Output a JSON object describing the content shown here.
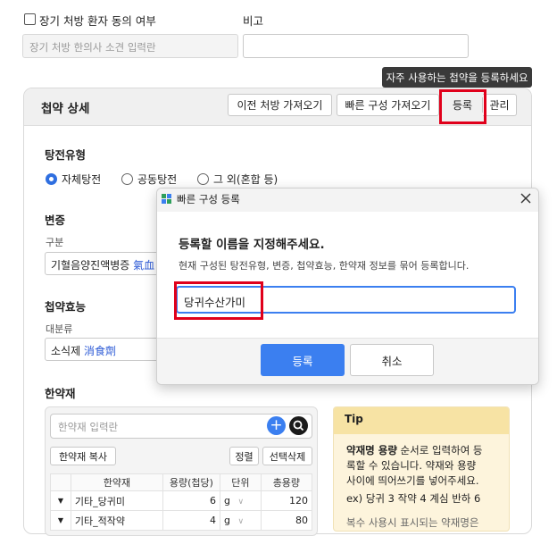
{
  "top": {
    "consent_label": "장기 처방 환자 동의 여부",
    "consent_placeholder": "장기 처방 한의사 소견 입력란",
    "memo_label": "비고",
    "memo_value": ""
  },
  "tooltip": {
    "text": "자주 사용하는 첩약을 등록하세요"
  },
  "card": {
    "title": "첩약 상세",
    "buttons": {
      "prev": "이전 처방 가져오기",
      "quick": "빠른 구성 가져오기",
      "register": "등록",
      "manage": "관리"
    },
    "decoction": {
      "title": "탕전유형",
      "options": [
        "자체탕전",
        "공동탕전",
        "그 외(혼합 등)"
      ],
      "selected": "자체탕전"
    },
    "pattern": {
      "title": "변증",
      "sub_label": "구분",
      "value": "기혈음양진액병증",
      "value_hanja": "氣血"
    },
    "efficacy": {
      "title": "첩약효능",
      "sub_label": "대분류",
      "value": "소식제",
      "value_hanja": "消食劑"
    },
    "herbs": {
      "title": "한약재",
      "search_placeholder": "한약재 입력란",
      "copy_button": "한약재 복사",
      "sort_button": "정렬",
      "delete_button": "선택삭제",
      "columns": [
        "한약재",
        "용량(첩당)",
        "단위",
        "총용량"
      ],
      "rows": [
        {
          "name": "기타_당귀미",
          "dose": "6",
          "unit": "g",
          "total": "120"
        },
        {
          "name": "기타_적작약",
          "dose": "4",
          "unit": "g",
          "total": "80"
        }
      ]
    },
    "tip": {
      "title": "Tip",
      "bold": "약재명 용량",
      "line1_rest": " 순서로 입력하여 등",
      "line2": "록할 수 있습니다. 약재와 용량",
      "line3": "사이에 띄어쓰기를 넣어주세요.",
      "line4": "ex) 당귀 3 작약 4 계심 반하 6",
      "line5": "복수 사용시 표시되는 약재명은"
    }
  },
  "dialog": {
    "title": "빠른 구성 등록",
    "heading": "등록할 이름을 지정해주세요.",
    "description": "현재 구성된 탕전유형, 변증, 첩약효능, 한약재 정보를 묶어 등록합니다.",
    "input_value": "당귀수산가미",
    "confirm": "등록",
    "cancel": "취소"
  },
  "colors": {
    "primary": "#3b7ff0",
    "highlight": "#e0001b",
    "tip_bg": "#fdf4dc"
  }
}
